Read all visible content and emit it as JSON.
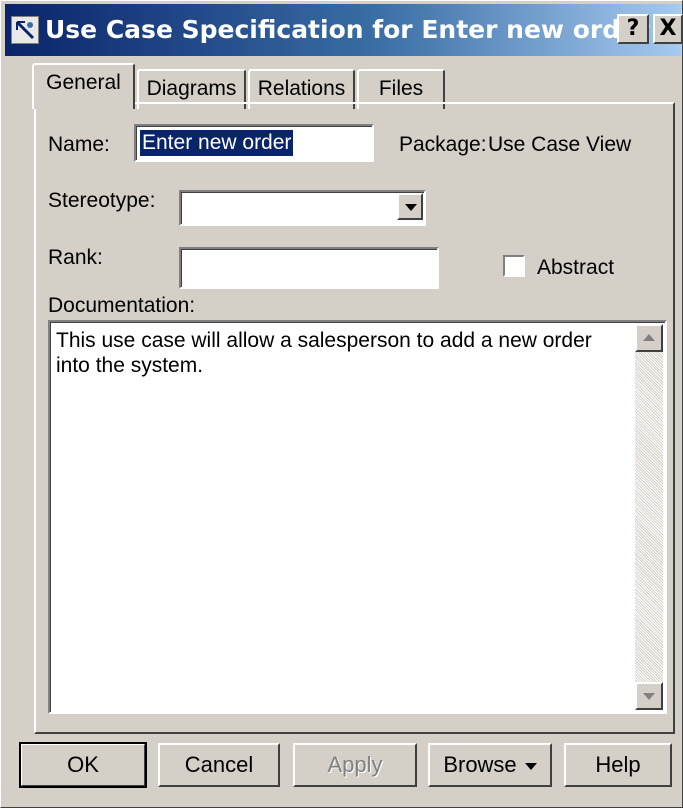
{
  "window": {
    "title": "Use Case Specification for Enter new order",
    "help_button": "?",
    "close_button": "X"
  },
  "tabs": [
    {
      "label": "General",
      "active": true
    },
    {
      "label": "Diagrams",
      "active": false
    },
    {
      "label": "Relations",
      "active": false
    },
    {
      "label": "Files",
      "active": false
    }
  ],
  "general": {
    "name_label": "Name:",
    "name_value": "Enter new order",
    "package_label": "Package:",
    "package_value": "Use Case View",
    "stereotype_label": "Stereotype:",
    "stereotype_value": "",
    "rank_label": "Rank:",
    "rank_value": "",
    "abstract_label": "Abstract",
    "abstract_checked": false,
    "documentation_label": "Documentation:",
    "documentation_text": "This use case will allow a salesperson to add a new order into the system."
  },
  "buttons": {
    "ok": "OK",
    "cancel": "Cancel",
    "apply": "Apply",
    "browse": "Browse",
    "help": "Help"
  }
}
